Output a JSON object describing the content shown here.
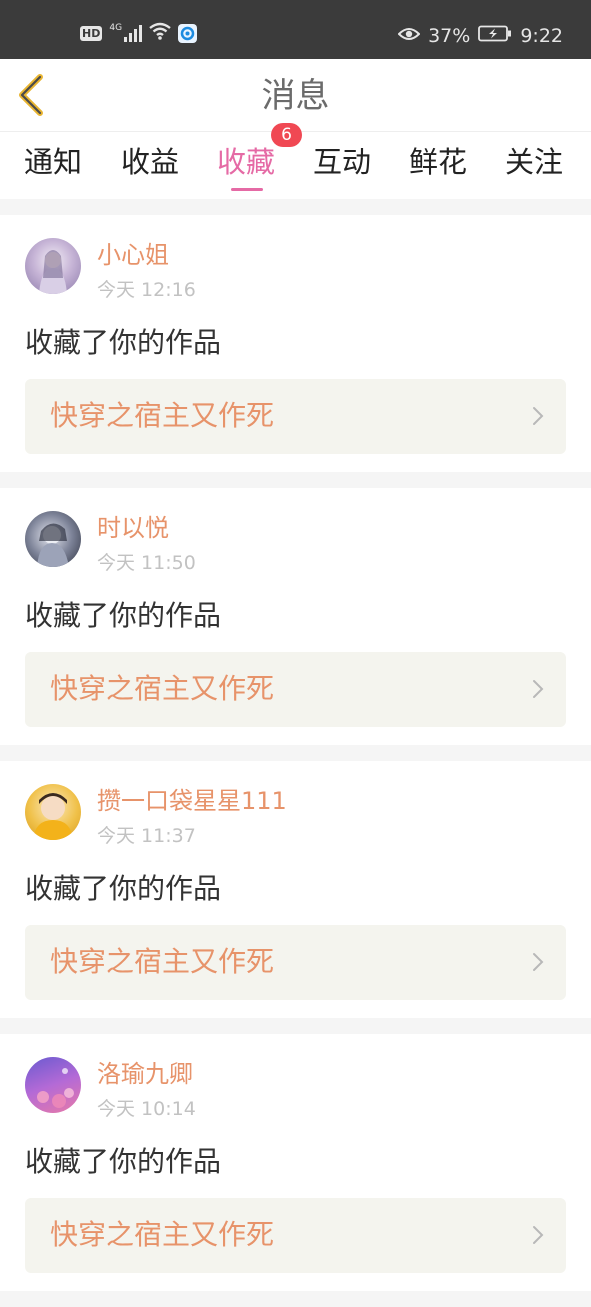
{
  "status_bar": {
    "hd": "HD",
    "network": "4G",
    "battery_percent": "37%",
    "time": "9:22",
    "icons": [
      "hd-icon",
      "signal-icon",
      "wifi-icon",
      "app-notification-icon",
      "eye-icon",
      "battery-icon"
    ]
  },
  "header": {
    "title": "消息",
    "back_icon": "chevron-left-icon"
  },
  "tabs": [
    {
      "label": "通知"
    },
    {
      "label": "收益"
    },
    {
      "label": "收藏",
      "active": true,
      "badge": "6"
    },
    {
      "label": "互动"
    },
    {
      "label": "鲜花"
    },
    {
      "label": "关注"
    }
  ],
  "messages": [
    {
      "user": "小心姐",
      "time": "今天 12:16",
      "text": "收藏了你的作品",
      "work": "快穿之宿主又作死"
    },
    {
      "user": "时以悦",
      "time": "今天 11:50",
      "text": "收藏了你的作品",
      "work": "快穿之宿主又作死"
    },
    {
      "user": "攒一口袋星星111",
      "time": "今天 11:37",
      "text": "收藏了你的作品",
      "work": "快穿之宿主又作死"
    },
    {
      "user": "洛瑜九卿",
      "time": "今天 10:14",
      "text": "收藏了你的作品",
      "work": "快穿之宿主又作死"
    }
  ],
  "colors": {
    "accent_pink": "#e56aa5",
    "name_orange": "#e7936a",
    "badge_red": "#f04853"
  }
}
